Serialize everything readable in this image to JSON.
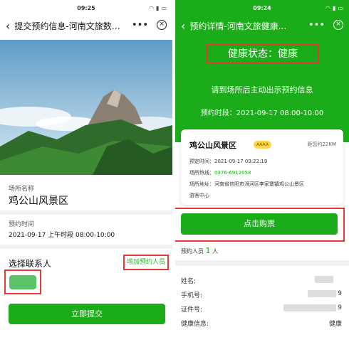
{
  "left": {
    "status": {
      "time": "09:25"
    },
    "nav": {
      "title": "提交预约信息-河南文旅数字...",
      "more": "•••"
    },
    "venue_label": "场所名称",
    "venue_name": "鸡公山风景区",
    "time_label": "预约时间",
    "time_value": "2021-09-17 上午时段 08:00-10:00",
    "contact_title": "选择联系人",
    "add_contact": "增加预约人员",
    "submit": "立即提交"
  },
  "right": {
    "status": {
      "time": "09:24"
    },
    "nav": {
      "title": "预约详情-河南文旅健康...",
      "more": "•••"
    },
    "health_status": "健康状态：健康",
    "hint": "请到场所后主动出示预约信息",
    "booking_time": "预约时段：2021-09-17 08:00-10:00",
    "card": {
      "name": "鸡公山风景区",
      "badge": "AAAA",
      "distance": "距您约22KM",
      "rows": [
        {
          "k": "预定时间：",
          "v": "2021-09-17 09:22:19"
        },
        {
          "k": "场所热线：",
          "v": "0376-6912058"
        },
        {
          "k": "场所地址：",
          "v": "河南省信阳市浉河区李家寨镇鸡公山景区"
        },
        {
          "k": "",
          "v": "游客中心"
        }
      ]
    },
    "buy": "点击购票",
    "people_label": "预约人员",
    "people_count": "1",
    "people_unit": "人",
    "info": [
      {
        "k": "姓名:",
        "v": ""
      },
      {
        "k": "手机号:",
        "v": "9"
      },
      {
        "k": "证件号:",
        "v": "9"
      },
      {
        "k": "健康信息:",
        "v": "健康"
      }
    ]
  },
  "colors": {
    "green": "#1aad19",
    "red_box": "#e53935"
  }
}
